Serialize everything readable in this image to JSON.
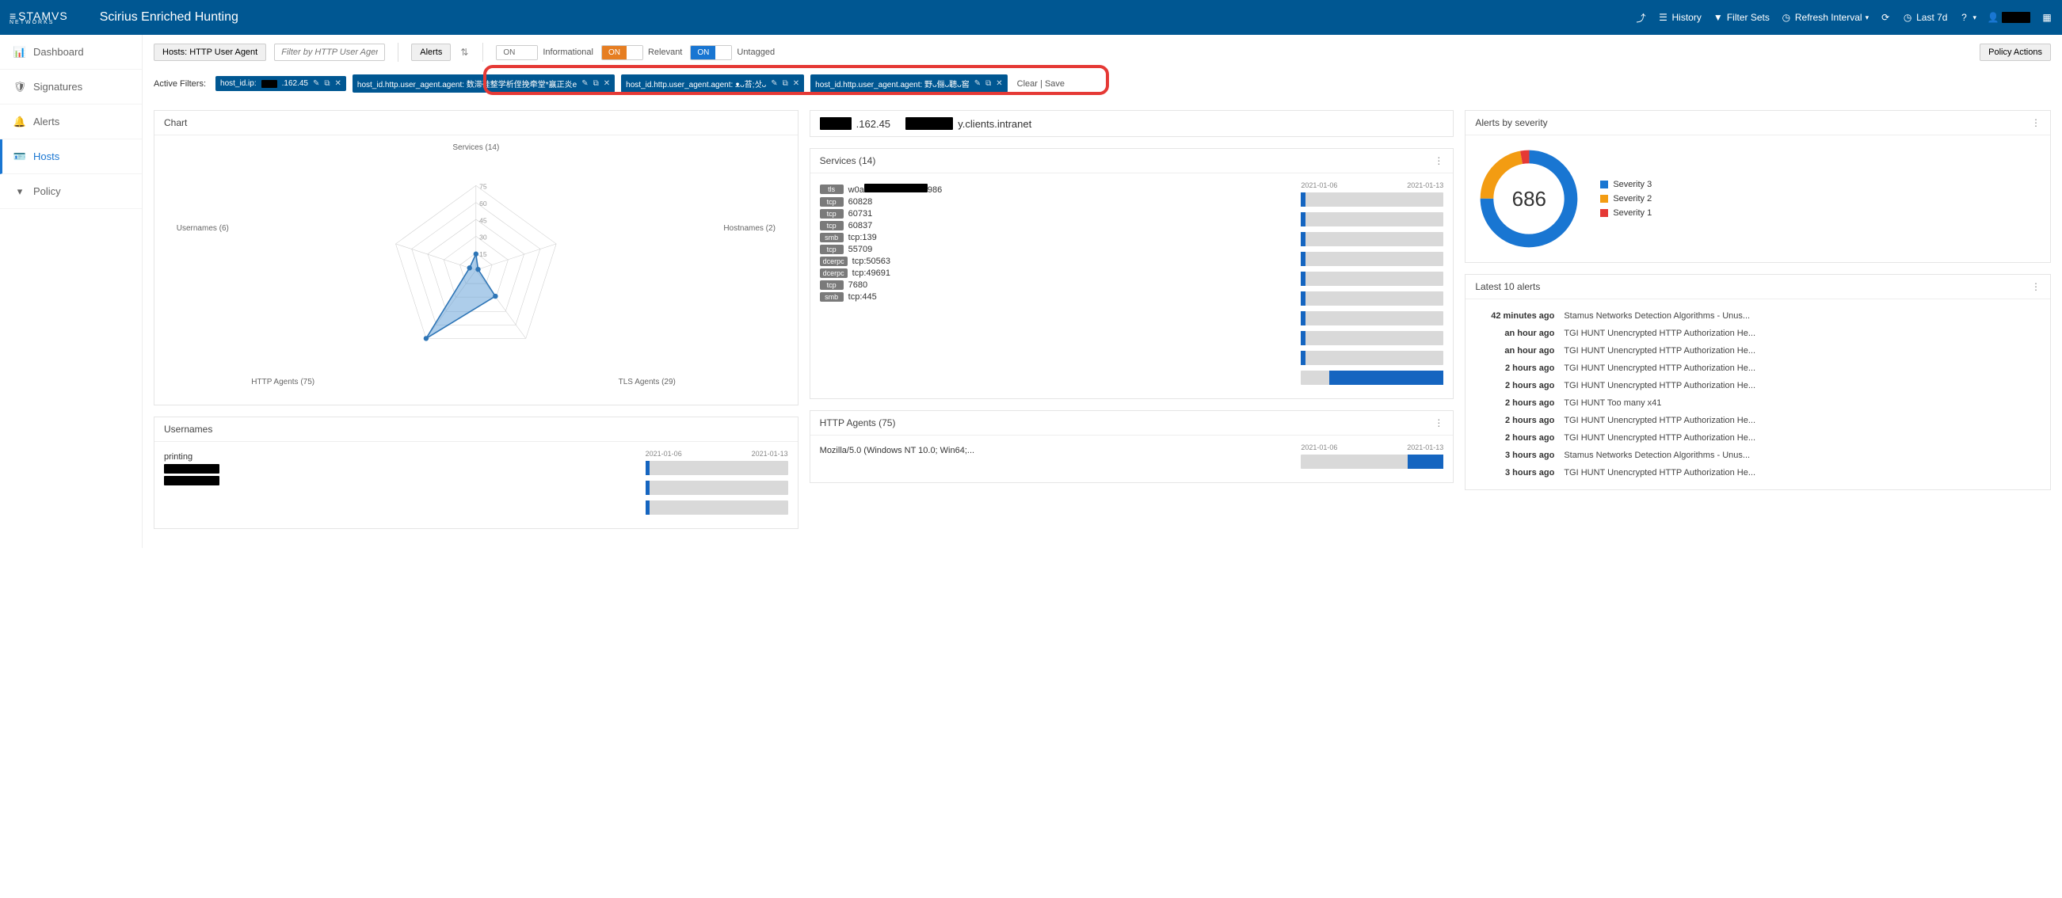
{
  "header": {
    "logo_top": "STAMVS",
    "logo_sub": "NETWORKS",
    "title": "Scirius Enriched Hunting",
    "history": "History",
    "filter_sets": "Filter Sets",
    "refresh_interval": "Refresh Interval",
    "last_period": "Last 7d"
  },
  "sidebar": {
    "items": [
      {
        "label": "Dashboard"
      },
      {
        "label": "Signatures"
      },
      {
        "label": "Alerts"
      },
      {
        "label": "Hosts"
      },
      {
        "label": "Policy"
      }
    ]
  },
  "toolbar": {
    "hosts_btn": "Hosts: HTTP User Agent",
    "filter_placeholder": "Filter by HTTP User Agent",
    "alerts_btn": "Alerts",
    "toggle_on": "ON",
    "informational": "Informational",
    "relevant": "Relevant",
    "untagged": "Untagged",
    "policy_actions": "Policy Actions"
  },
  "filters": {
    "label": "Active Filters:",
    "chips": [
      {
        "text_pre": "host_id.ip: ",
        "text_post": ".162.45"
      },
      {
        "text_pre": "host_id.http.user_agent.agent: 数滞硅整学析侄挽牵堂*赢正炎e",
        "text_post": ""
      },
      {
        "text_pre": "host_id.http.user_agent.agent: ᴥᴗ苔;삿ᴗ",
        "text_post": ""
      },
      {
        "text_pre": "host_id.http.user_agent.agent: 野ᴗ俪ᴗ聽ᴗ窖",
        "text_post": ""
      }
    ],
    "clear": "Clear",
    "save": "Save"
  },
  "chart_panel": {
    "title": "Chart"
  },
  "chart_data": {
    "type": "radar",
    "axes": [
      {
        "label": "Services (14)",
        "value": 14
      },
      {
        "label": "Hostnames (2)",
        "value": 2
      },
      {
        "label": "TLS Agents (29)",
        "value": 29
      },
      {
        "label": "HTTP Agents (75)",
        "value": 75
      },
      {
        "label": "Usernames (6)",
        "value": 6
      }
    ],
    "rings": [
      15,
      30,
      45,
      60,
      75
    ],
    "max": 75
  },
  "host_summary": {
    "ip_suffix": ".162.45",
    "domain_suffix": "y.clients.intranet"
  },
  "services_panel": {
    "title": "Services (14)",
    "date_start": "2021-01-06",
    "date_end": "2021-01-13",
    "rows": [
      {
        "proto": "tls",
        "label_pre": "w0a",
        "label_post": "986",
        "redact": true,
        "fill_l": 3,
        "fill_r": 0
      },
      {
        "proto": "tcp",
        "label_pre": "60828",
        "label_post": "",
        "redact": false,
        "fill_l": 3,
        "fill_r": 0
      },
      {
        "proto": "tcp",
        "label_pre": "60731",
        "label_post": "",
        "redact": false,
        "fill_l": 3,
        "fill_r": 0
      },
      {
        "proto": "tcp",
        "label_pre": "60837",
        "label_post": "",
        "redact": false,
        "fill_l": 3,
        "fill_r": 0
      },
      {
        "proto": "smb",
        "label_pre": "tcp:139",
        "label_post": "",
        "redact": false,
        "fill_l": 3,
        "fill_r": 0
      },
      {
        "proto": "tcp",
        "label_pre": "55709",
        "label_post": "",
        "redact": false,
        "fill_l": 3,
        "fill_r": 0
      },
      {
        "proto": "dcerpc",
        "label_pre": "tcp:50563",
        "label_post": "",
        "redact": false,
        "fill_l": 3,
        "fill_r": 0
      },
      {
        "proto": "dcerpc",
        "label_pre": "tcp:49691",
        "label_post": "",
        "redact": false,
        "fill_l": 3,
        "fill_r": 0
      },
      {
        "proto": "tcp",
        "label_pre": "7680",
        "label_post": "",
        "redact": false,
        "fill_l": 3,
        "fill_r": 0
      },
      {
        "proto": "smb",
        "label_pre": "tcp:445",
        "label_post": "",
        "redact": false,
        "fill_l": 0,
        "fill_r": 80
      }
    ]
  },
  "usernames_panel": {
    "title": "Usernames",
    "date_start": "2021-01-06",
    "date_end": "2021-01-13",
    "rows": [
      {
        "label": "printing",
        "redact": false
      },
      {
        "label": "",
        "redact": true
      },
      {
        "label": "",
        "redact": true
      }
    ]
  },
  "http_agents_panel": {
    "title": "HTTP Agents (75)",
    "date_start": "2021-01-06",
    "date_end": "2021-01-13",
    "rows": [
      {
        "label": "Mozilla/5.0 (Windows NT 10.0; Win64;...",
        "fill_r": 25
      }
    ]
  },
  "severity_panel": {
    "title": "Alerts by severity",
    "total": "686",
    "legend": [
      {
        "label": "Severity 3",
        "color": "#1976d2"
      },
      {
        "label": "Severity 2",
        "color": "#f39c12"
      },
      {
        "label": "Severity 1",
        "color": "#e53935"
      }
    ],
    "slices": {
      "sev3": 75,
      "sev2": 22,
      "sev1": 3
    }
  },
  "latest_panel": {
    "title": "Latest 10 alerts",
    "rows": [
      {
        "time": "42 minutes ago",
        "msg": "Stamus Networks Detection Algorithms - Unus..."
      },
      {
        "time": "an hour ago",
        "msg": "TGI HUNT Unencrypted HTTP Authorization He..."
      },
      {
        "time": "an hour ago",
        "msg": "TGI HUNT Unencrypted HTTP Authorization He..."
      },
      {
        "time": "2 hours ago",
        "msg": "TGI HUNT Unencrypted HTTP Authorization He..."
      },
      {
        "time": "2 hours ago",
        "msg": "TGI HUNT Unencrypted HTTP Authorization He..."
      },
      {
        "time": "2 hours ago",
        "msg": "TGI HUNT Too many x41"
      },
      {
        "time": "2 hours ago",
        "msg": "TGI HUNT Unencrypted HTTP Authorization He..."
      },
      {
        "time": "2 hours ago",
        "msg": "TGI HUNT Unencrypted HTTP Authorization He..."
      },
      {
        "time": "3 hours ago",
        "msg": "Stamus Networks Detection Algorithms - Unus..."
      },
      {
        "time": "3 hours ago",
        "msg": "TGI HUNT Unencrypted HTTP Authorization He..."
      }
    ]
  }
}
